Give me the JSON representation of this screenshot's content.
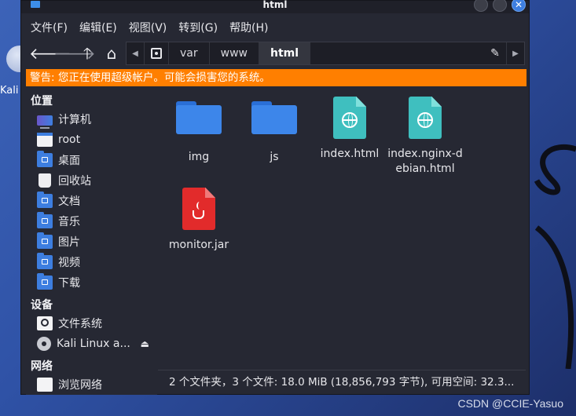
{
  "desktop": {
    "label": "Kali Li",
    "watermark": "CSDN @CCIE-Yasuo"
  },
  "window": {
    "title": "html"
  },
  "menu": [
    "文件(F)",
    "编辑(E)",
    "视图(V)",
    "转到(G)",
    "帮助(H)"
  ],
  "toolbar": {
    "path": [
      "var",
      "www",
      "html"
    ],
    "active_crumb": "html"
  },
  "warning": "警告: 您正在使用超级帐户。可能会损害您的系统。",
  "sidebar": {
    "places_header": "位置",
    "places": [
      {
        "label": "计算机",
        "icon": "computer-icon"
      },
      {
        "label": "root",
        "icon": "home-folder-icon"
      },
      {
        "label": "桌面",
        "icon": "desktop-folder-icon"
      },
      {
        "label": "回收站",
        "icon": "trash-icon"
      },
      {
        "label": "文档",
        "icon": "documents-folder-icon"
      },
      {
        "label": "音乐",
        "icon": "music-folder-icon"
      },
      {
        "label": "图片",
        "icon": "pictures-folder-icon"
      },
      {
        "label": "视频",
        "icon": "videos-folder-icon"
      },
      {
        "label": "下载",
        "icon": "downloads-folder-icon"
      }
    ],
    "devices_header": "设备",
    "devices": [
      {
        "label": "文件系统",
        "icon": "drive-icon"
      },
      {
        "label": "Kali Linux a...",
        "icon": "optical-disc-icon"
      }
    ],
    "network_header": "网络",
    "network": [
      {
        "label": "浏览网络",
        "icon": "network-icon"
      }
    ]
  },
  "files": [
    {
      "name": "img",
      "type": "folder"
    },
    {
      "name": "js",
      "type": "folder"
    },
    {
      "name": "index.html",
      "type": "html"
    },
    {
      "name": "index.nginx-debian.html",
      "type": "html"
    },
    {
      "name": "monitor.jar",
      "type": "jar"
    }
  ],
  "status": "2 个文件夹，3 个文件: 18.0 MiB (18,856,793 字节), 可用空间: 32.3..."
}
